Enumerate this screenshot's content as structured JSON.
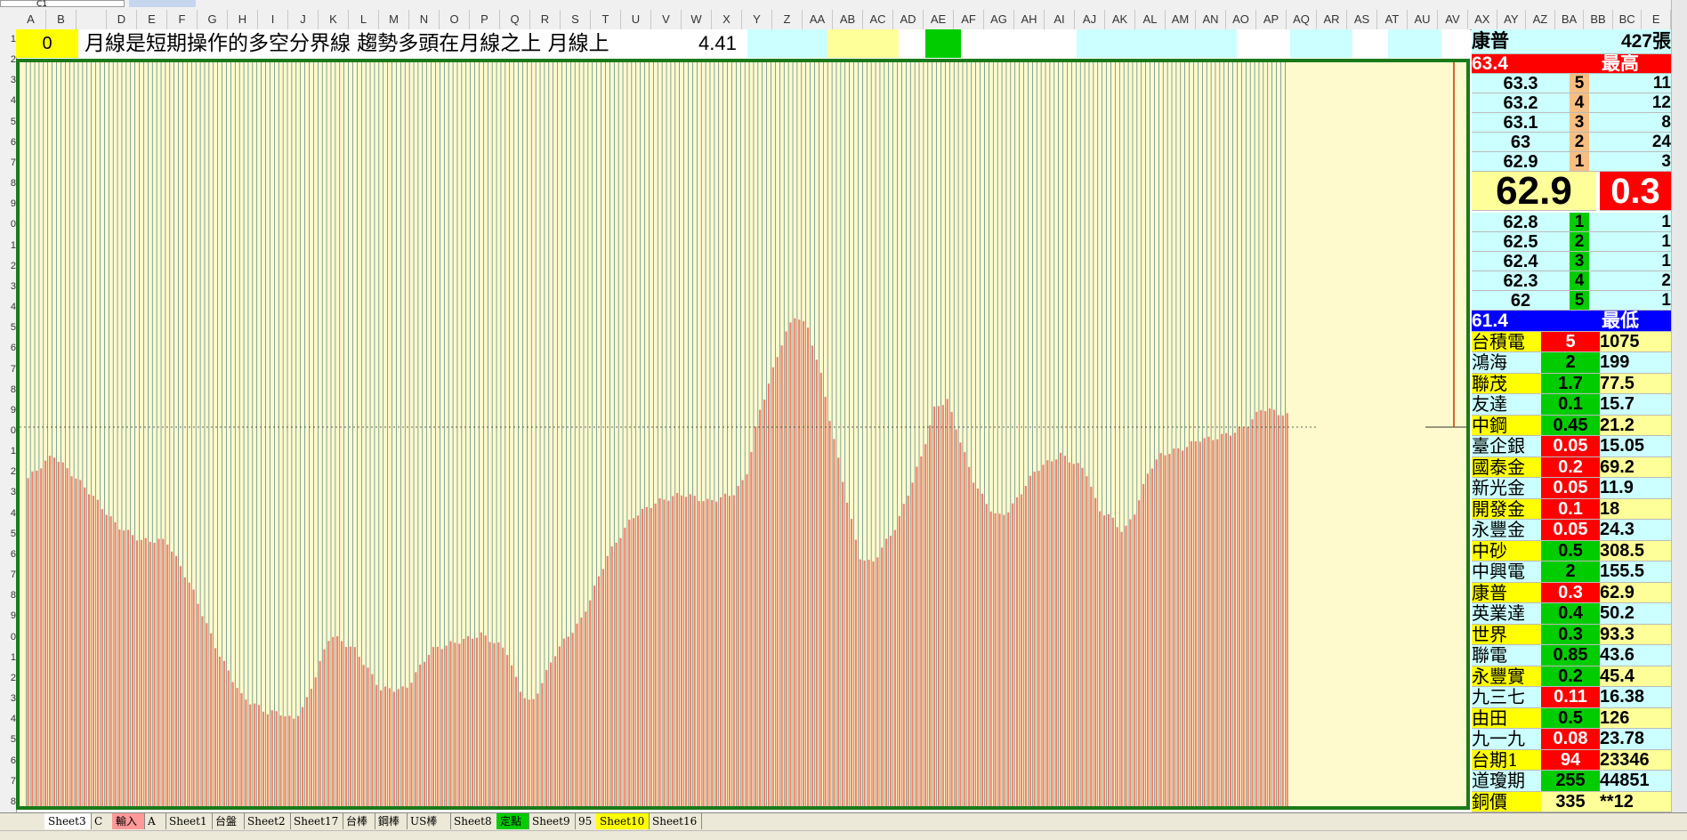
{
  "formula_bar": {
    "name_box": "C1"
  },
  "columns": [
    "A",
    "B",
    "",
    "D",
    "E",
    "F",
    "G",
    "H",
    "I",
    "J",
    "K",
    "L",
    "M",
    "N",
    "O",
    "P",
    "Q",
    "R",
    "S",
    "T",
    "U",
    "V",
    "W",
    "X",
    "Y",
    "Z",
    "AA",
    "AB",
    "AC",
    "AD",
    "AE",
    "AF",
    "AG",
    "AH",
    "AI",
    "AJ",
    "AK",
    "AL",
    "AM",
    "AN",
    "AO",
    "AP",
    "AQ",
    "AR",
    "AS",
    "AT",
    "AU",
    "AV",
    "AX",
    "AY",
    "AZ",
    "BA",
    "BB",
    "BC",
    "E"
  ],
  "rows": [
    "1",
    "2",
    "3",
    "4",
    "5",
    "6",
    "7",
    "8",
    "9",
    "0",
    "1",
    "2",
    "3",
    "4",
    "5",
    "6",
    "7",
    "8",
    "9",
    "0",
    "1",
    "2",
    "3",
    "4",
    "5",
    "6",
    "7",
    "8",
    "9",
    "0",
    "1",
    "2",
    "3",
    "4",
    "5",
    "6",
    "7",
    "8"
  ],
  "row1": {
    "cell_a": "0",
    "message": "月線是短期操作的多空分界線  趨勢多頭在月線之上   月線上",
    "value": "4.41"
  },
  "panel": {
    "stock_name": "康普",
    "volume": "427張",
    "high_price": "63.4",
    "high_label": "最高",
    "asks": [
      {
        "price": "63.3",
        "level": "5",
        "qty": "11"
      },
      {
        "price": "63.2",
        "level": "4",
        "qty": "12"
      },
      {
        "price": "63.1",
        "level": "3",
        "qty": "8"
      },
      {
        "price": "63",
        "level": "2",
        "qty": "24"
      },
      {
        "price": "62.9",
        "level": "1",
        "qty": "3"
      }
    ],
    "last_price": "62.9",
    "change": "0.3",
    "bids": [
      {
        "price": "62.8",
        "level": "1",
        "qty": "1"
      },
      {
        "price": "62.5",
        "level": "2",
        "qty": "1"
      },
      {
        "price": "62.4",
        "level": "3",
        "qty": "1"
      },
      {
        "price": "62.3",
        "level": "4",
        "qty": "2"
      },
      {
        "price": "62",
        "level": "5",
        "qty": "1"
      }
    ],
    "low_price": "61.4",
    "low_label": "最低",
    "watchlist": [
      {
        "name": "台積電",
        "change": "5",
        "price": "1075",
        "up": true
      },
      {
        "name": "鴻海",
        "change": "2",
        "price": "199",
        "up": false
      },
      {
        "name": "聯茂",
        "change": "1.7",
        "price": "77.5",
        "up": false
      },
      {
        "name": "友達",
        "change": "0.1",
        "price": "15.7",
        "up": false
      },
      {
        "name": "中鋼",
        "change": "0.45",
        "price": "21.2",
        "up": false
      },
      {
        "name": "臺企銀",
        "change": "0.05",
        "price": "15.05",
        "up": true
      },
      {
        "name": "國泰金",
        "change": "0.2",
        "price": "69.2",
        "up": true
      },
      {
        "name": "新光金",
        "change": "0.05",
        "price": "11.9",
        "up": true
      },
      {
        "name": "開發金",
        "change": "0.1",
        "price": "18",
        "up": true
      },
      {
        "name": "永豐金",
        "change": "0.05",
        "price": "24.3",
        "up": true
      },
      {
        "name": "中砂",
        "change": "0.5",
        "price": "308.5",
        "up": false
      },
      {
        "name": "中興電",
        "change": "2",
        "price": "155.5",
        "up": false
      },
      {
        "name": "康普",
        "change": "0.3",
        "price": "62.9",
        "up": true
      },
      {
        "name": "英業達",
        "change": "0.4",
        "price": "50.2",
        "up": false
      },
      {
        "name": "世界",
        "change": "0.3",
        "price": "93.3",
        "up": false
      },
      {
        "name": "聯電",
        "change": "0.85",
        "price": "43.6",
        "up": false
      },
      {
        "name": "永豐實",
        "change": "0.2",
        "price": "45.4",
        "up": false
      },
      {
        "name": "九三七",
        "change": "0.11",
        "price": "16.38",
        "up": true
      },
      {
        "name": "由田",
        "change": "0.5",
        "price": "126",
        "up": false
      },
      {
        "name": "九一九",
        "change": "0.08",
        "price": "23.78",
        "up": true
      },
      {
        "name": "台期1",
        "change": "94",
        "price": "23346",
        "up": true
      },
      {
        "name": "道瓊期",
        "change": "255",
        "price": "44851",
        "up": false
      },
      {
        "name": "銅價",
        "change": "335",
        "price": "**12",
        "up": null
      }
    ]
  },
  "sheet_tabs": [
    "Sheet3",
    "C",
    "輸入",
    "A",
    "Sheet1",
    "台盤",
    "Sheet2",
    "Sheet17",
    "台棒",
    "鋼棒",
    "US棒",
    "Sheet8",
    "定點",
    "Sheet9",
    "95",
    "Sheet10",
    "Sheet16"
  ],
  "colors": {
    "bar": "#f4806a",
    "grid": "#2e6b7a",
    "frame": "#1a7a1a",
    "chart_bg": "#fffacd",
    "up": "#ff0000",
    "down": "#00cc00"
  }
}
